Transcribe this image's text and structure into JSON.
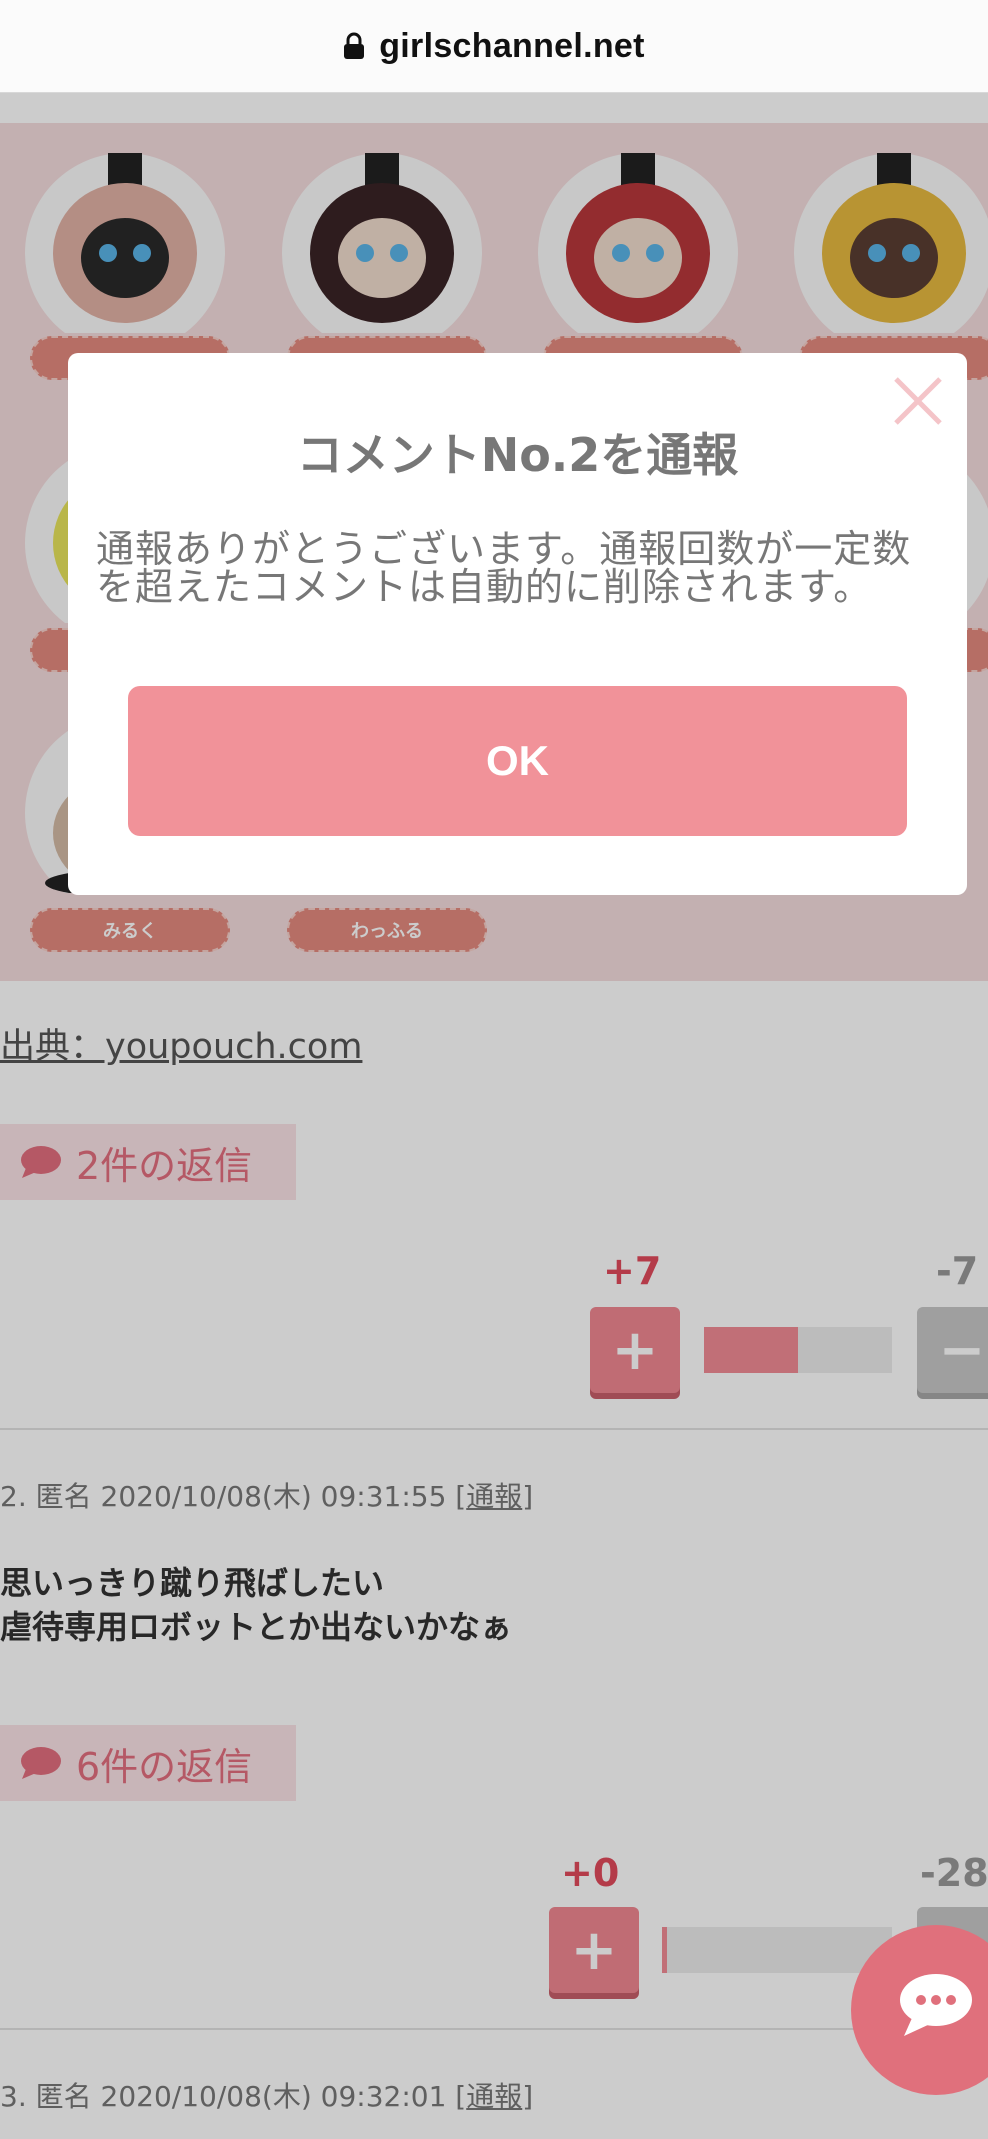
{
  "browser": {
    "url": "girlschannel.net"
  },
  "image_grid": {
    "tags": [
      "",
      "",
      "",
      "",
      "",
      "",
      "みるく",
      "わっふる"
    ]
  },
  "source": {
    "label": "出典：youpouch.com"
  },
  "comment1_footer": {
    "reply_label": "2件の返信",
    "plus_count": "+7",
    "minus_count": "-7",
    "plus_ratio": 0.5
  },
  "comment2": {
    "meta": "2. 匿名 2020/10/08(木) 09:31:55 [",
    "report": "通報",
    "meta_end": "]",
    "line1": "思いっきり蹴り飛ばしたい",
    "line2": "虐待専用ロボットとか出ないかなぁ",
    "reply_label": "6件の返信",
    "plus_count": "+0",
    "minus_count": "-28",
    "plus_ratio": 0.02
  },
  "comment3": {
    "meta": "3. 匿名 2020/10/08(木) 09:32:01 [",
    "report": "通報",
    "meta_end": "]"
  },
  "modal": {
    "title": "コメントNo.2を通報",
    "message": "通報ありがとうございます。通報回数が一定数を超えたコメントは自動的に削除されます。",
    "ok_label": "OK"
  },
  "colors": {
    "accent": "#f19299",
    "plus": "#e24a5c"
  }
}
